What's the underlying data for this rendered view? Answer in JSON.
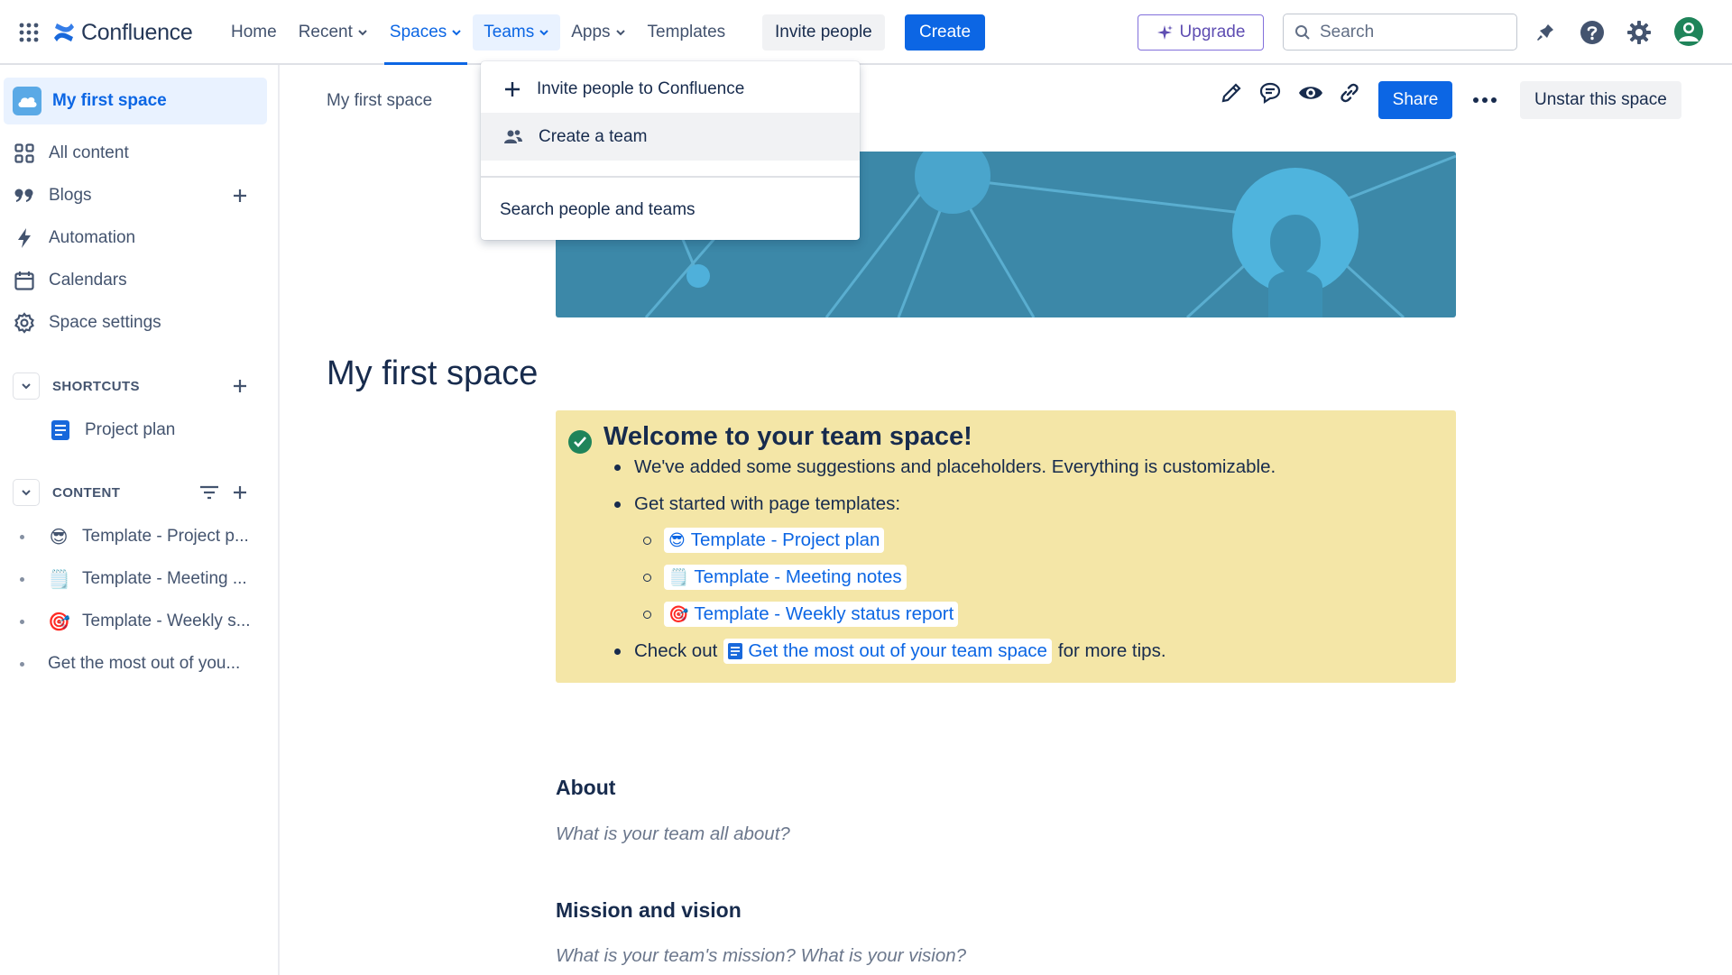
{
  "header": {
    "app_name": "Confluence",
    "nav": [
      {
        "label": "Home",
        "dropdown": false
      },
      {
        "label": "Recent",
        "dropdown": true
      },
      {
        "label": "Spaces",
        "dropdown": true,
        "state": "current"
      },
      {
        "label": "Teams",
        "dropdown": true,
        "state": "open"
      },
      {
        "label": "Apps",
        "dropdown": true
      },
      {
        "label": "Templates",
        "dropdown": false
      }
    ],
    "invite_label": "Invite people",
    "create_label": "Create",
    "upgrade_label": "Upgrade",
    "search_placeholder": "Search",
    "icons": [
      "app-switcher-icon",
      "notifications-icon",
      "help-icon",
      "settings-icon",
      "profile-icon"
    ]
  },
  "teams_menu": {
    "items": [
      {
        "label": "Invite people to Confluence",
        "icon": "plus-icon"
      },
      {
        "label": "Create a team",
        "icon": "people-icon",
        "hovered": true
      }
    ],
    "footer": "Search people and teams"
  },
  "sidebar": {
    "space_name": "My first space",
    "items": [
      {
        "label": "All content",
        "icon": "grid-icon"
      },
      {
        "label": "Blogs",
        "icon": "quote-icon",
        "has_add": true
      },
      {
        "label": "Automation",
        "icon": "lightning-icon"
      },
      {
        "label": "Calendars",
        "icon": "calendar-icon"
      },
      {
        "label": "Space settings",
        "icon": "gear-icon"
      }
    ],
    "shortcuts": {
      "title": "SHORTCUTS",
      "items": [
        {
          "label": "Project plan",
          "icon": "page-icon"
        }
      ]
    },
    "content": {
      "title": "CONTENT",
      "items": [
        {
          "label": "Template - Project p...",
          "emoji": "😎"
        },
        {
          "label": "Template - Meeting ...",
          "emoji": "🗒️"
        },
        {
          "label": "Template - Weekly s...",
          "emoji": "🎯"
        },
        {
          "label": "Get the most out of you...",
          "emoji": ""
        }
      ]
    }
  },
  "page": {
    "breadcrumb": "My first space",
    "actions": [
      "edit-icon",
      "comment-icon",
      "watch-icon",
      "link-icon"
    ],
    "share_label": "Share",
    "more_icon": "more-icon",
    "unstar_label": "Unstar this space",
    "title": "My first space",
    "panel": {
      "title": "Welcome to your team space!",
      "line1": "We've added some suggestions and placeholders. Everything is customizable.",
      "line2": "Get started with page templates:",
      "templates": [
        {
          "emoji": "😎",
          "label": "Template - Project plan"
        },
        {
          "emoji": "🗒️",
          "label": "Template - Meeting notes"
        },
        {
          "emoji": "🎯",
          "label": "Template - Weekly status report"
        }
      ],
      "check_prefix": "Check out",
      "check_link": "Get the most out of your team space",
      "check_suffix": "for more tips."
    },
    "sections": [
      {
        "heading": "About",
        "placeholder": "What is your team all about?"
      },
      {
        "heading": "Mission and vision",
        "placeholder": "What is your team's mission? What is your vision?"
      }
    ]
  },
  "colors": {
    "accent": "#0c66e4",
    "panel": "#f4e6a7",
    "banner": "#3c88a8",
    "upgrade": "#8270db"
  }
}
